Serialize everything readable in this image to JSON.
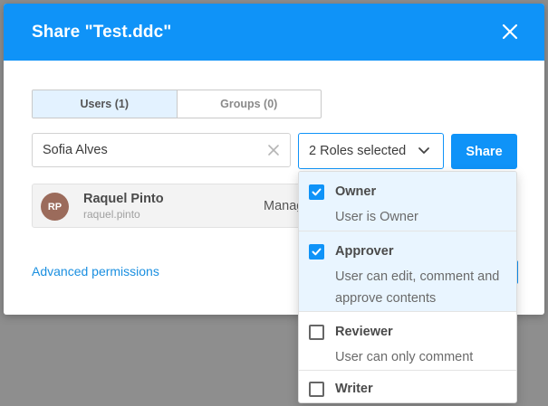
{
  "dialog": {
    "title": "Share \"Test.ddc\""
  },
  "tabs": [
    {
      "label": "Users (1)",
      "active": true
    },
    {
      "label": "Groups (0)",
      "active": false
    }
  ],
  "user_search": {
    "value": "Sofia Alves"
  },
  "roles_select": {
    "label": "2 Roles selected"
  },
  "share_button": {
    "label": "Share"
  },
  "shared_user": {
    "initials": "RP",
    "name": "Raquel Pinto",
    "login": "raquel.pinto",
    "role": "Manag"
  },
  "advanced_link": {
    "label": "Advanced permissions"
  },
  "roles_options": [
    {
      "title": "Owner",
      "description": "User is Owner",
      "checked": true
    },
    {
      "title": "Approver",
      "description": "User can edit, comment and approve contents",
      "checked": true
    },
    {
      "title": "Reviewer",
      "description": "User can only comment",
      "checked": false
    },
    {
      "title": "Writer",
      "description": "",
      "checked": false
    }
  ],
  "colors": {
    "primary": "#0f93f8",
    "selected_bg": "#e9f5ff",
    "avatar": "#9b6b5b"
  }
}
